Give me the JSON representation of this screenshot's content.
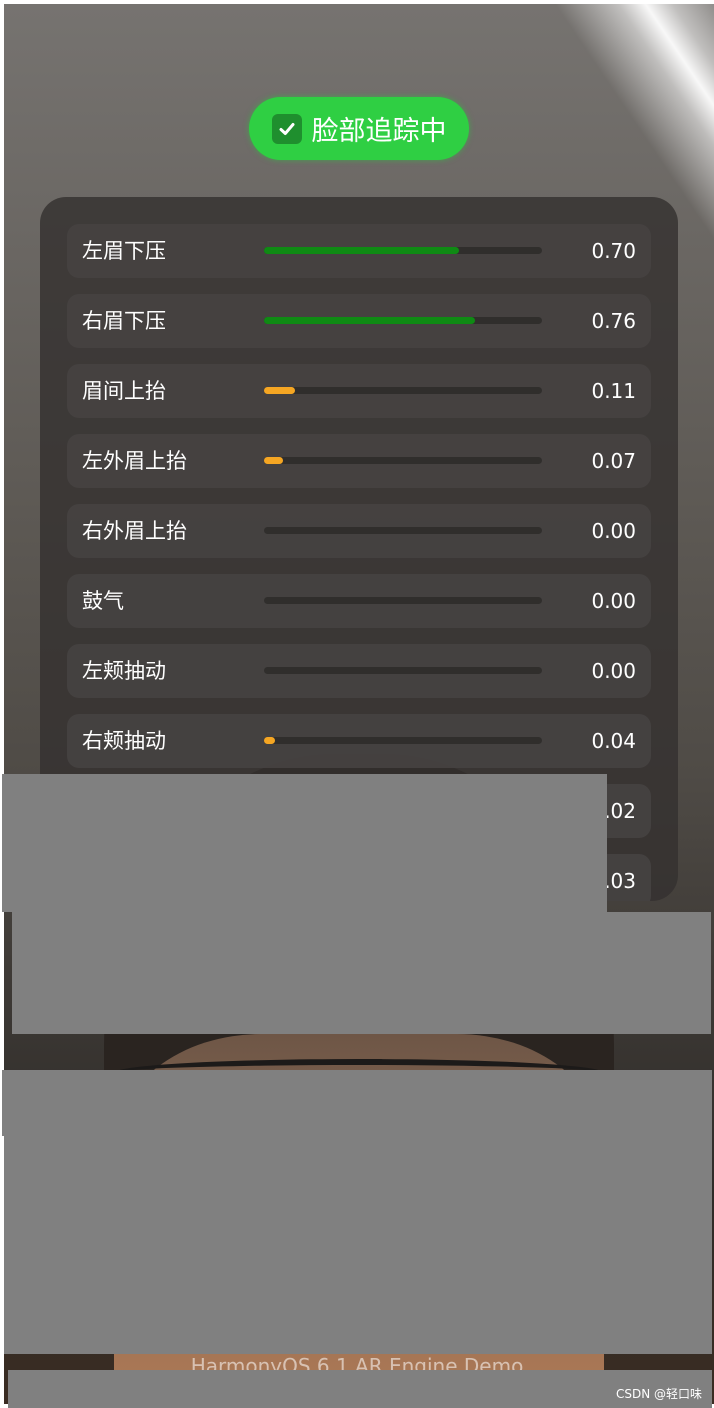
{
  "status": {
    "label": "脸部追踪中",
    "color": "#2fcf43"
  },
  "colors": {
    "high": "#0f8a14",
    "low": "#f5a623"
  },
  "blendshapes": [
    {
      "label": "左眉下压",
      "value": "0.70",
      "level": 0.7,
      "color": "#0f8a14"
    },
    {
      "label": "右眉下压",
      "value": "0.76",
      "level": 0.76,
      "color": "#0f8a14"
    },
    {
      "label": "眉间上抬",
      "value": "0.11",
      "level": 0.11,
      "color": "#f5a623"
    },
    {
      "label": "左外眉上抬",
      "value": "0.07",
      "level": 0.07,
      "color": "#f5a623"
    },
    {
      "label": "右外眉上抬",
      "value": "0.00",
      "level": 0.0,
      "color": "#f5a623"
    },
    {
      "label": "鼓气",
      "value": "0.00",
      "level": 0.0,
      "color": "#f5a623"
    },
    {
      "label": "左颊抽动",
      "value": "0.00",
      "level": 0.0,
      "color": "#f5a623"
    },
    {
      "label": "右颊抽动",
      "value": "0.04",
      "level": 0.04,
      "color": "#f5a623"
    },
    {
      "label": "",
      "value": ".02",
      "level": 0.02,
      "color": "#f5a623"
    },
    {
      "label": "",
      "value": "0.03",
      "level": 0.03,
      "color": "#f5a623"
    }
  ],
  "footer": {
    "text": "HarmonyOS 6.1 AR Engine Demo"
  },
  "watermark": {
    "text": "CSDN @轻口味"
  }
}
